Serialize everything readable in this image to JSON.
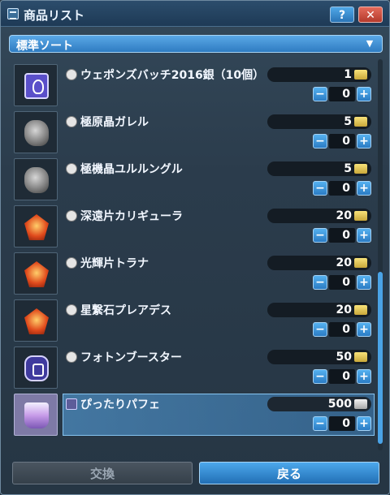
{
  "window": {
    "title": "商品リスト",
    "help_label": "?",
    "close_label": "✕"
  },
  "sort": {
    "label": "標準ソート"
  },
  "items": [
    {
      "name": "ウェポンズバッチ2016銀（10個）",
      "price": "1",
      "qty": "0",
      "thumb": "badge-icon"
    },
    {
      "name": "極原晶ガレル",
      "price": "5",
      "qty": "0",
      "thumb": "ore-icon"
    },
    {
      "name": "極機晶ユルルングル",
      "price": "5",
      "qty": "0",
      "thumb": "ore-icon"
    },
    {
      "name": "深遠片カリギューラ",
      "price": "20",
      "qty": "0",
      "thumb": "crystal-icon"
    },
    {
      "name": "光輝片トラナ",
      "price": "20",
      "qty": "0",
      "thumb": "crystal-icon"
    },
    {
      "name": "星繋石プレアデス",
      "price": "20",
      "qty": "0",
      "thumb": "crystal-icon"
    },
    {
      "name": "フォトンブースター",
      "price": "50",
      "qty": "0",
      "thumb": "booster-icon"
    },
    {
      "name": "ぴったりパフェ",
      "price": "500",
      "qty": "0",
      "thumb": "parfait-icon"
    }
  ],
  "buttons": {
    "minus": "−",
    "plus": "+",
    "exchange": "交換",
    "back": "戻る"
  },
  "colors": {
    "accent": "#3a8fd6",
    "selected_row": "#5aaaeb",
    "gold_currency": "#e2c55a",
    "silver_currency": "#d0d0d0"
  }
}
